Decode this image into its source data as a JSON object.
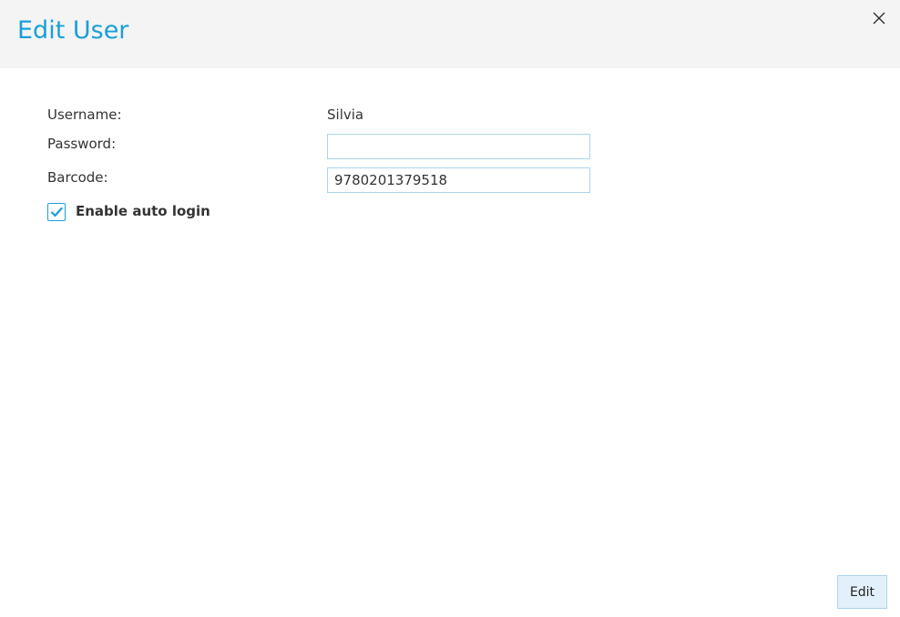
{
  "dialog": {
    "title": "Edit User",
    "close_icon": "close-icon"
  },
  "form": {
    "username_label": "Username:",
    "username_value": "Silvia",
    "password_label": "Password:",
    "password_value": "",
    "barcode_label": "Barcode:",
    "barcode_value": "9780201379518",
    "auto_login_label": "Enable auto login",
    "auto_login_checked": true
  },
  "footer": {
    "edit_label": "Edit"
  },
  "colors": {
    "accent": "#1a9fd8",
    "header_bg": "#f4f4f4",
    "field_border": "#a9d6ea",
    "button_bg": "#e2f0fb"
  }
}
